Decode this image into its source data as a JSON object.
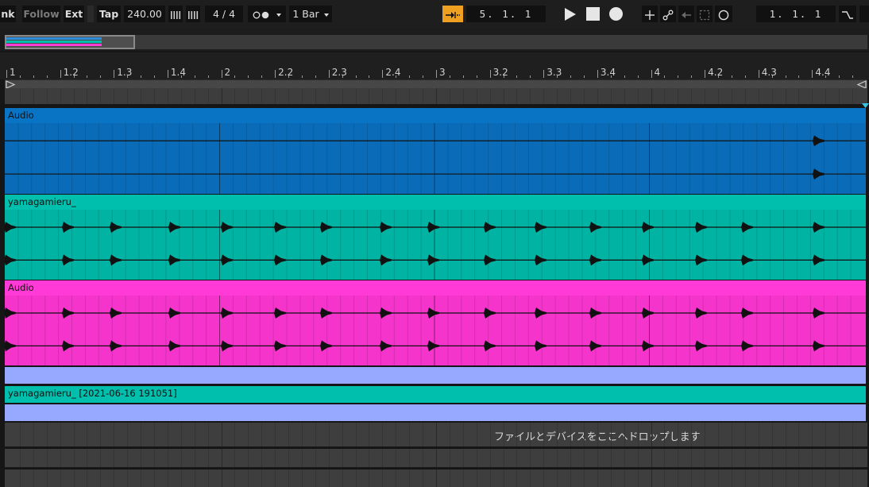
{
  "control_bar": {
    "link_label": "nk",
    "follow_label": "Follow",
    "ext_label": "Ext",
    "tap_label": "Tap",
    "tempo": "240.00",
    "time_signature": "4 / 4",
    "quantize": "1 Bar",
    "arrangement_position": "5.  1.  1",
    "loop_start": "1.  1.  1"
  },
  "ruler": {
    "labels": [
      "1",
      "1.2",
      "1.3",
      "1.4",
      "2",
      "2.2",
      "2.3",
      "2.4",
      "3",
      "3.2",
      "3.3",
      "3.4",
      "4",
      "4.2",
      "4.3",
      "4.4"
    ]
  },
  "tracks": [
    {
      "clip_name": "Audio",
      "color": "#0a74c4"
    },
    {
      "clip_name": "yamagamieru_",
      "color": "#00bfad"
    },
    {
      "clip_name": "Audio",
      "color": "#ff3ad6"
    },
    {
      "clip_name": "",
      "color": "#97a8ff"
    },
    {
      "clip_name": "yamagamieru_ [2021-06-16 191051]",
      "color": "#00bfad"
    },
    {
      "clip_name": "",
      "color": "#97a8ff"
    }
  ],
  "drop_area_text": "ファイルとデバイスをここへドロップします",
  "colors": {
    "accent_orange": "#f0a020",
    "background": "#161616"
  },
  "icons": [
    "play-icon",
    "stop-icon",
    "record-icon",
    "add-icon",
    "automation-icon",
    "back-arrow-icon",
    "capture-icon",
    "loop-circle-icon",
    "punch-icon",
    "follow-arrow-icon"
  ]
}
